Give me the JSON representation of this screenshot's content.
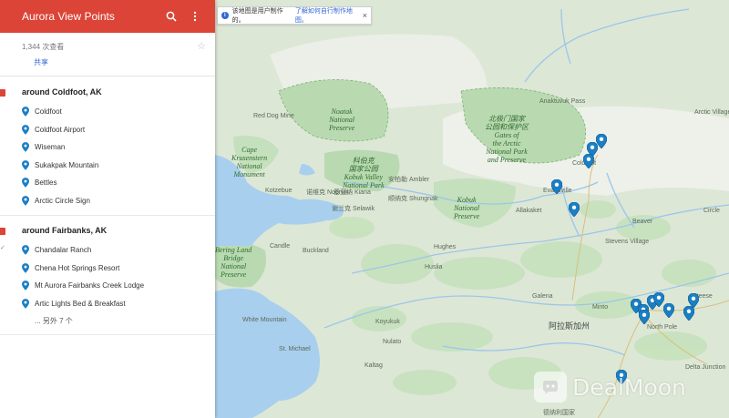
{
  "header": {
    "title": "Aurora View Points",
    "view_count": "1,344 次查看",
    "share_label": "共享"
  },
  "notice": {
    "text": "该地图是用户制作的。",
    "link": "了解如何自行制作地图。",
    "close": "×"
  },
  "layers": [
    {
      "title": "around Coldfoot, AK",
      "items": [
        "Coldfoot",
        "Coldfoot Airport",
        "Wiseman",
        "Sukakpak Mountain",
        "Bettles",
        "Arctic Circle Sign"
      ]
    },
    {
      "title": "around Fairbanks, AK",
      "items": [
        "Chandalar Ranch",
        "Chena Hot Springs Resort",
        "Mt Aurora Fairbanks Creek Lodge",
        "Artic Lights Bed & Breakfast"
      ],
      "more": "... 另外 7 个"
    }
  ],
  "map": {
    "park_labels": [
      "Noatak\nNational\nPreserve",
      "北极门国家\n公园和保护区\nGates of\nthe Arctic\nNational Park\nand Preserve",
      "科伯克\n国家公园\nKobuk Valley\nNational Park",
      "Kobuk\nNational\nPreserve",
      "Cape\nKrusenstern\nNational\nMonument",
      "Bering Land\nBridge\nNational\nPreserve",
      "阿拉斯加州"
    ],
    "place_labels": [
      "Red Dog Mine",
      "Kotzebue",
      "诺维克 Noorvik",
      "基亚纳 Kiana",
      "安柏勒 Ambler",
      "顺纳克 Shungnak",
      "谢兰克 Selawik",
      "Buckland",
      "Candle",
      "Alatna",
      "Allakaket",
      "Hughes",
      "Huslia",
      "Galena",
      "Ruby",
      "Koyukuk",
      "Nulato",
      "Kaltag",
      "Unalakleet",
      "Stevens Village",
      "Beaver",
      "Fairbanks",
      "North Pole",
      "Delta Junction",
      "Arctic Village",
      "Venetie",
      "Fort Yukon",
      "Circle",
      "Tok",
      "Anaktuvuk Pass",
      "White Mountain",
      "Nome",
      "Shaktoolik",
      "Koyuk",
      "Elim",
      "St. Michael",
      "Manley Hot Springs",
      "Minto",
      "Nenana",
      "Steese Volcano",
      "Coldfoot",
      "Evansville",
      "Kaltag",
      "Saint Mary's",
      "德纳利国家",
      "Steese"
    ]
  },
  "watermark": "DealMoon",
  "colors": {
    "header_bg": "#db4437",
    "pin": "#1a7fc4",
    "link": "#3367d6",
    "water": "#a4cdf0",
    "park": "#b8dbb0"
  }
}
